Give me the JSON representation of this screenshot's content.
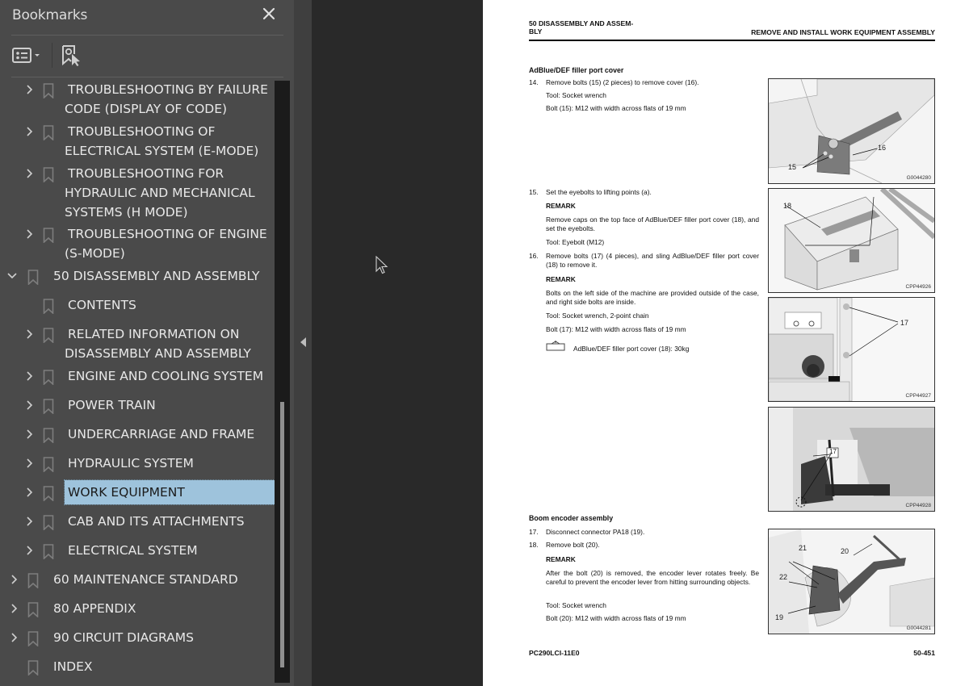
{
  "sidebar": {
    "title": "Bookmarks",
    "close_icon": "close-icon",
    "toolbar": {
      "options_icon": "list-options-icon",
      "find_current_icon": "find-current-bookmark-icon"
    },
    "items": [
      {
        "label_lines": [
          "TROUBLESHOOTING BY FAILURE",
          "CODE (DISPLAY OF CODE)"
        ],
        "level": 2,
        "expandable": true,
        "expanded": false
      },
      {
        "label_lines": [
          "TROUBLESHOOTING OF",
          "ELECTRICAL SYSTEM (E-MODE)"
        ],
        "level": 2,
        "expandable": true,
        "expanded": false
      },
      {
        "label_lines": [
          "TROUBLESHOOTING FOR",
          "HYDRAULIC AND MECHANICAL",
          "SYSTEMS (H MODE)"
        ],
        "level": 2,
        "expandable": true,
        "expanded": false
      },
      {
        "label_lines": [
          "TROUBLESHOOTING OF ENGINE",
          "(S-MODE)"
        ],
        "level": 2,
        "expandable": true,
        "expanded": false
      },
      {
        "label_lines": [
          "50 DISASSEMBLY AND ASSEMBLY"
        ],
        "level": 1,
        "expandable": true,
        "expanded": true
      },
      {
        "label_lines": [
          "CONTENTS"
        ],
        "level": 2,
        "expandable": false,
        "expanded": false
      },
      {
        "label_lines": [
          "RELATED INFORMATION ON",
          "DISASSEMBLY AND ASSEMBLY"
        ],
        "level": 2,
        "expandable": true,
        "expanded": false
      },
      {
        "label_lines": [
          "ENGINE AND COOLING SYSTEM"
        ],
        "level": 2,
        "expandable": true,
        "expanded": false
      },
      {
        "label_lines": [
          "POWER TRAIN"
        ],
        "level": 2,
        "expandable": true,
        "expanded": false
      },
      {
        "label_lines": [
          "UNDERCARRIAGE AND FRAME"
        ],
        "level": 2,
        "expandable": true,
        "expanded": false
      },
      {
        "label_lines": [
          "HYDRAULIC SYSTEM"
        ],
        "level": 2,
        "expandable": true,
        "expanded": false
      },
      {
        "label_lines": [
          "WORK EQUIPMENT"
        ],
        "level": 2,
        "expandable": true,
        "expanded": false,
        "selected": true
      },
      {
        "label_lines": [
          "CAB AND ITS ATTACHMENTS"
        ],
        "level": 2,
        "expandable": true,
        "expanded": false
      },
      {
        "label_lines": [
          "ELECTRICAL SYSTEM"
        ],
        "level": 2,
        "expandable": true,
        "expanded": false
      },
      {
        "label_lines": [
          "60 MAINTENANCE STANDARD"
        ],
        "level": 1,
        "expandable": true,
        "expanded": false
      },
      {
        "label_lines": [
          "80 APPENDIX"
        ],
        "level": 1,
        "expandable": true,
        "expanded": false
      },
      {
        "label_lines": [
          "90 CIRCUIT DIAGRAMS"
        ],
        "level": 1,
        "expandable": true,
        "expanded": false
      },
      {
        "label_lines": [
          "INDEX"
        ],
        "level": 1,
        "expandable": false,
        "expanded": false
      }
    ],
    "selected_color": "#9ec3dc"
  },
  "document": {
    "header_left_lines": [
      "50 DISASSEMBLY AND ASSEM-",
      "BLY"
    ],
    "header_right": "REMOVE AND INSTALL WORK EQUIPMENT ASSEMBLY",
    "section1": {
      "title": "AdBlue/DEF filler port cover",
      "step14": {
        "num": "14.",
        "text": "Remove bolts (15) (2 pieces) to remove cover (16).",
        "tool": "Tool: Socket wrench",
        "bolt": "Bolt (15): M12 with width across flats of 19 mm"
      },
      "step15": {
        "num": "15.",
        "text": "Set the eyebolts to lifting points (a).",
        "remark_label": "REMARK",
        "remark": "Remove caps on the top face of AdBlue/DEF filler port cover (18), and set the eyebolts.",
        "tool": "Tool: Eyebolt (M12)"
      },
      "step16": {
        "num": "16.",
        "text": "Remove bolts (17) (4 pieces), and sling AdBlue/DEF filler port cover (18) to remove it.",
        "remark_label": "REMARK",
        "remark": "Bolts on the left side of the machine are provided outside of the case, and right side bolts are inside.",
        "tool": "Tool: Socket wrench, 2-point chain",
        "bolt": "Bolt (17): M12 with width across flats of 19 mm",
        "weight": "AdBlue/DEF filler port cover (18): 30kg"
      }
    },
    "section2": {
      "title": "Boom encoder assembly",
      "step17": {
        "num": "17.",
        "text": "Disconnect connector PA18 (19)."
      },
      "step18": {
        "num": "18.",
        "text": "Remove bolt (20).",
        "remark_label": "REMARK",
        "remark": "After the bolt (20) is removed, the encoder lever rotates freely. Be careful to prevent the encoder lever from hitting surrounding objects.",
        "tool": "Tool: Socket wrench",
        "bolt": "Bolt (20): M12 with width across flats of 19 mm"
      }
    },
    "figures": [
      {
        "code": "G0044280",
        "callouts": [
          "15",
          "16"
        ]
      },
      {
        "code": "CPP44926",
        "callouts": [
          "18"
        ]
      },
      {
        "code": "CPP44927",
        "callouts": [
          "17"
        ]
      },
      {
        "code": "CPP44928",
        "callouts": [
          "17"
        ]
      },
      {
        "code": "G0044281",
        "callouts": [
          "21",
          "20",
          "22",
          "19"
        ]
      }
    ],
    "footer_left": "PC290LCI-11E0",
    "footer_right": "50-451"
  }
}
